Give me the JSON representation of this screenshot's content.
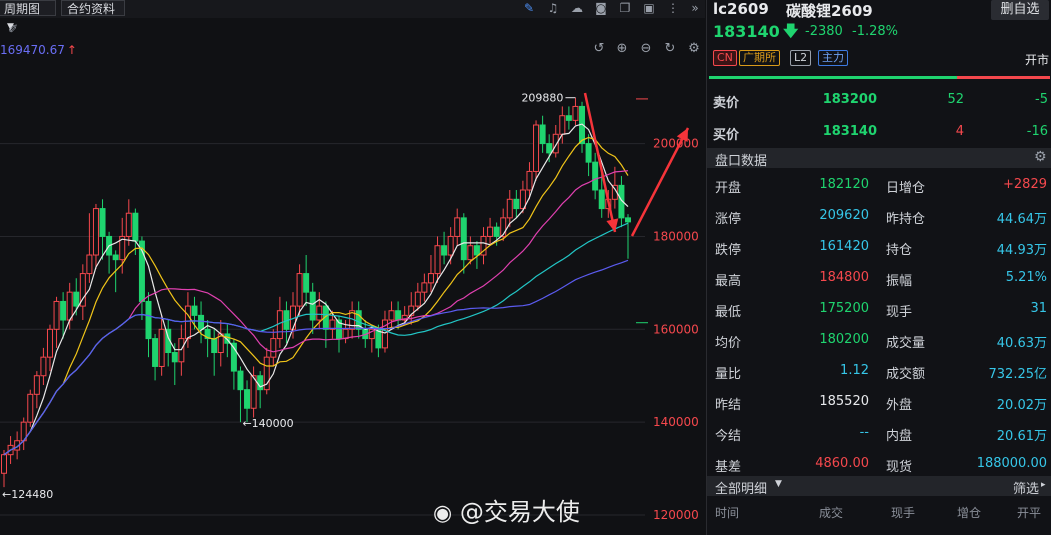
{
  "toolbar": {
    "period_label": "周期图",
    "contract_info_label": "合约资料",
    "price_readout": "169470.67"
  },
  "watermark": "@交易大使",
  "header": {
    "symbol": "lc2609",
    "name": "碳酸锂2609",
    "remove_button": "删自选",
    "last_price": "183140",
    "change": "-2380",
    "change_pct": "-1.28%",
    "tags": [
      "CN",
      "广期所",
      "L2",
      "主力"
    ],
    "market_status": "开市"
  },
  "order_book": {
    "ask": {
      "label": "卖价",
      "price": "183200",
      "volume": "52",
      "change": "-5"
    },
    "bid": {
      "label": "买价",
      "price": "183140",
      "volume": "4",
      "change": "-16"
    }
  },
  "section_title": "盘口数据",
  "stats": [
    {
      "l1": "开盘",
      "v1": "182120",
      "c1": "green",
      "l2": "日增仓",
      "v2": "+2829",
      "c2": "red"
    },
    {
      "l1": "涨停",
      "v1": "209620",
      "c1": "cyan",
      "l2": "昨持仓",
      "v2": "44.64万",
      "c2": "cyan"
    },
    {
      "l1": "跌停",
      "v1": "161420",
      "c1": "cyan",
      "l2": "持仓",
      "v2": "44.93万",
      "c2": "cyan"
    },
    {
      "l1": "最高",
      "v1": "184800",
      "c1": "red",
      "l2": "振幅",
      "v2": "5.21%",
      "c2": "cyan"
    },
    {
      "l1": "最低",
      "v1": "175200",
      "c1": "green",
      "l2": "现手",
      "v2": "31",
      "c2": "cyan"
    },
    {
      "l1": "均价",
      "v1": "180200",
      "c1": "green",
      "l2": "成交量",
      "v2": "40.63万",
      "c2": "cyan"
    },
    {
      "l1": "量比",
      "v1": "1.12",
      "c1": "cyan",
      "l2": "成交额",
      "v2": "732.25亿",
      "c2": "cyan"
    },
    {
      "l1": "昨结",
      "v1": "185520",
      "c1": "white",
      "l2": "外盘",
      "v2": "20.02万",
      "c2": "cyan"
    },
    {
      "l1": "今结",
      "v1": "--",
      "c1": "cyan",
      "l2": "内盘",
      "v2": "20.61万",
      "c2": "cyan"
    },
    {
      "l1": "基差",
      "v1": "4860.00",
      "c1": "red",
      "l2": "现货",
      "v2": "188000.00",
      "c2": "cyan"
    }
  ],
  "detail": {
    "title": "全部明细",
    "filter": "筛选",
    "columns": [
      "时间",
      "成交",
      "现手",
      "增仓",
      "开平"
    ]
  },
  "chart_data": {
    "type": "candlestick",
    "y_ticks": [
      200000,
      180000,
      160000,
      140000,
      120000
    ],
    "ylim": [
      115700,
      218000
    ],
    "reference_lines": [
      209620,
      161420
    ],
    "annotations": [
      {
        "text": "209880",
        "value": 209880
      },
      {
        "text": "140000",
        "value": 140000
      },
      {
        "text": "124480",
        "value": 124480
      }
    ],
    "colors": {
      "up": "#f5484d",
      "down": "#1fd46f",
      "ma5": "#e9e9e9",
      "ma10": "#f0c419",
      "ma20": "#e040b0",
      "ma40": "#22c6c6",
      "ma60": "#5b5bf0",
      "arrow": "#f5343a"
    },
    "candles": [
      [
        129000,
        133000,
        126000,
        134000
      ],
      [
        133000,
        135000,
        131000,
        137000
      ],
      [
        134000,
        136000,
        132000,
        138000
      ],
      [
        136000,
        140000,
        134000,
        141000
      ],
      [
        140000,
        146000,
        139000,
        147000
      ],
      [
        146000,
        150000,
        143000,
        151000
      ],
      [
        150000,
        154000,
        148000,
        156000
      ],
      [
        154000,
        160000,
        151000,
        161000
      ],
      [
        160000,
        166000,
        156000,
        167000
      ],
      [
        166000,
        162000,
        158000,
        168000
      ],
      [
        162000,
        168000,
        160000,
        170000
      ],
      [
        168000,
        165000,
        163000,
        171000
      ],
      [
        165000,
        172000,
        162000,
        174000
      ],
      [
        172000,
        176000,
        170000,
        185000
      ],
      [
        176000,
        186000,
        173000,
        187000
      ],
      [
        186000,
        180000,
        175000,
        188000
      ],
      [
        180000,
        176000,
        172000,
        181000
      ],
      [
        176000,
        175000,
        168000,
        177000
      ],
      [
        175000,
        180000,
        172000,
        184000
      ],
      [
        180000,
        185000,
        178000,
        188000
      ],
      [
        185000,
        179000,
        176000,
        186000
      ],
      [
        179000,
        166000,
        162000,
        180000
      ],
      [
        166000,
        158000,
        154000,
        168000
      ],
      [
        158000,
        152000,
        149000,
        159000
      ],
      [
        152000,
        160000,
        150000,
        163000
      ],
      [
        160000,
        155000,
        152000,
        162000
      ],
      [
        155000,
        153000,
        148000,
        157000
      ],
      [
        153000,
        158000,
        150000,
        161000
      ],
      [
        158000,
        165000,
        156000,
        168000
      ],
      [
        165000,
        163000,
        160000,
        167000
      ],
      [
        163000,
        160000,
        157000,
        166000
      ],
      [
        160000,
        158000,
        154000,
        162000
      ],
      [
        158000,
        155000,
        150000,
        160000
      ],
      [
        155000,
        159000,
        152000,
        162000
      ],
      [
        159000,
        157000,
        154000,
        161000
      ],
      [
        157000,
        151000,
        147000,
        158000
      ],
      [
        151000,
        147000,
        140000,
        152000
      ],
      [
        147000,
        143000,
        140000,
        149000
      ],
      [
        143000,
        150000,
        141000,
        152000
      ],
      [
        150000,
        147000,
        143000,
        151000
      ],
      [
        147000,
        154000,
        146000,
        156000
      ],
      [
        154000,
        158000,
        152000,
        160000
      ],
      [
        158000,
        164000,
        156000,
        167000
      ],
      [
        164000,
        160000,
        157000,
        166000
      ],
      [
        160000,
        165000,
        158000,
        168000
      ],
      [
        165000,
        172000,
        163000,
        174000
      ],
      [
        172000,
        168000,
        165000,
        176000
      ],
      [
        168000,
        162000,
        159000,
        170000
      ],
      [
        162000,
        165000,
        160000,
        168000
      ],
      [
        165000,
        160000,
        156000,
        166000
      ],
      [
        160000,
        162000,
        158000,
        164000
      ],
      [
        162000,
        158000,
        155000,
        163000
      ],
      [
        158000,
        160000,
        157000,
        162000
      ],
      [
        160000,
        164000,
        158000,
        166000
      ],
      [
        164000,
        160000,
        158000,
        166000
      ],
      [
        160000,
        158000,
        156000,
        162000
      ],
      [
        158000,
        160000,
        155000,
        161000
      ],
      [
        160000,
        156000,
        154000,
        161000
      ],
      [
        156000,
        162000,
        155000,
        164000
      ],
      [
        162000,
        164000,
        160000,
        166000
      ],
      [
        164000,
        162000,
        160000,
        166000
      ],
      [
        162000,
        163000,
        161000,
        165000
      ],
      [
        163000,
        165000,
        161000,
        168000
      ],
      [
        165000,
        168000,
        164000,
        170000
      ],
      [
        168000,
        170000,
        166000,
        172000
      ],
      [
        170000,
        172000,
        168000,
        176000
      ],
      [
        172000,
        178000,
        170000,
        180000
      ],
      [
        178000,
        176000,
        174000,
        181000
      ],
      [
        176000,
        180000,
        174000,
        182000
      ],
      [
        180000,
        184000,
        178000,
        186000
      ],
      [
        184000,
        175000,
        172000,
        185000
      ],
      [
        175000,
        178000,
        174000,
        180000
      ],
      [
        178000,
        176000,
        173000,
        179000
      ],
      [
        176000,
        180000,
        174000,
        182000
      ],
      [
        180000,
        182000,
        178000,
        184000
      ],
      [
        182000,
        180000,
        178000,
        183000
      ],
      [
        180000,
        184000,
        179000,
        186000
      ],
      [
        184000,
        188000,
        182000,
        190000
      ],
      [
        188000,
        186000,
        184000,
        190000
      ],
      [
        186000,
        190000,
        185000,
        192000
      ],
      [
        190000,
        194000,
        188000,
        196000
      ],
      [
        194000,
        204000,
        192000,
        205000
      ],
      [
        204000,
        200000,
        198000,
        206000
      ],
      [
        200000,
        198000,
        196000,
        202000
      ],
      [
        198000,
        202000,
        197000,
        204000
      ],
      [
        202000,
        206000,
        200000,
        208000
      ],
      [
        206000,
        205000,
        203000,
        208000
      ],
      [
        205000,
        208000,
        204000,
        209880
      ],
      [
        208000,
        200000,
        198000,
        209000
      ],
      [
        200000,
        196000,
        193000,
        202000
      ],
      [
        196000,
        190000,
        188000,
        198000
      ],
      [
        190000,
        186000,
        184000,
        194000
      ],
      [
        186000,
        188000,
        184000,
        190000
      ],
      [
        188000,
        191000,
        186000,
        195000
      ],
      [
        191000,
        184000,
        182000,
        193000
      ],
      [
        184000,
        183140,
        175200,
        184800
      ]
    ]
  }
}
